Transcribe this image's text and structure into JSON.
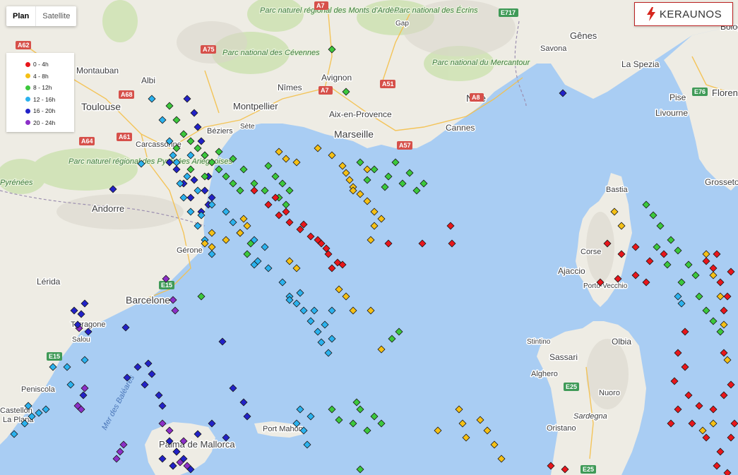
{
  "map_type": {
    "plan": "Plan",
    "satellite": "Satellite",
    "selected": "Plan"
  },
  "brand": {
    "name": "KERAUNOS"
  },
  "legend": [
    {
      "label": "0 - 4h",
      "color": "#e8161b"
    },
    {
      "label": "4 - 8h",
      "color": "#f5c015"
    },
    {
      "label": "8 - 12h",
      "color": "#3cc83c"
    },
    {
      "label": "12 - 16h",
      "color": "#2bb2ee"
    },
    {
      "label": "16 - 20h",
      "color": "#2222c8"
    },
    {
      "label": "20 - 24h",
      "color": "#8c2fc8"
    }
  ],
  "places": [
    "Montauban",
    "Albi",
    "Toulouse",
    "Carcassonne",
    "Andorre",
    "Lérida",
    "Tarragone",
    "Salou",
    "Barcelone",
    "Gérone",
    "Peniscola",
    "Castellón",
    "La Plana",
    "Montpellier",
    "Nîmes",
    "Avignon",
    "Sète",
    "Béziers",
    "Aix-en-Provence",
    "Marseille",
    "Gap",
    "Cannes",
    "Nice",
    "Gênes",
    "Savona",
    "La Spezia",
    "Pise",
    "Livourne",
    "Florence",
    "Grosseto",
    "Bastia",
    "Ajaccio",
    "Corse",
    "Porto-Vecchio",
    "Stintino",
    "Sassari",
    "Olbia",
    "Alghero",
    "Nuoro",
    "Sardegna",
    "Oristano",
    "Port Mahon",
    "Palma de Mallorca",
    "Bologna",
    "Mer des Baléares"
  ],
  "parks": [
    "Parc naturel régional des Pyrénées Ariégeoises",
    "Parc national des Cévennes",
    "Parc naturel régional des Monts d'Ardèche",
    "Parc national des Écrins",
    "Parc national du Mercantour",
    "Pyrénées"
  ],
  "roads": [
    "A62",
    "A68",
    "A61",
    "A64",
    "A75",
    "A7",
    "A7",
    "A51",
    "A57",
    "A8",
    "E717",
    "E76",
    "E15",
    "E15",
    "E25",
    "E25"
  ],
  "strikes": {
    "clusters": [
      {
        "bin": "0 - 4h",
        "points": [
          [
            360,
            270
          ],
          [
            380,
            290
          ],
          [
            395,
            305
          ],
          [
            410,
            315
          ],
          [
            425,
            325
          ],
          [
            440,
            335
          ],
          [
            455,
            345
          ],
          [
            465,
            360
          ],
          [
            478,
            372
          ],
          [
            470,
            380
          ],
          [
            430,
            318
          ],
          [
            405,
            300
          ],
          [
            390,
            280
          ],
          [
            450,
            340
          ],
          [
            462,
            352
          ],
          [
            485,
            375
          ],
          [
            550,
            345
          ],
          [
            598,
            345
          ],
          [
            640,
            345
          ],
          [
            638,
            320
          ],
          [
            860,
            345
          ],
          [
            880,
            360
          ],
          [
            900,
            350
          ],
          [
            920,
            370
          ],
          [
            940,
            360
          ],
          [
            900,
            390
          ],
          [
            875,
            395
          ],
          [
            915,
            400
          ],
          [
            850,
            400
          ],
          [
            1010,
            380
          ],
          [
            1020,
            400
          ],
          [
            1030,
            420
          ],
          [
            1000,
            370
          ],
          [
            1015,
            360
          ],
          [
            1035,
            385
          ],
          [
            1025,
            440
          ],
          [
            960,
            500
          ],
          [
            970,
            520
          ],
          [
            955,
            540
          ],
          [
            975,
            560
          ],
          [
            990,
            575
          ],
          [
            1010,
            580
          ],
          [
            1025,
            560
          ],
          [
            1035,
            545
          ],
          [
            980,
            600
          ],
          [
            1000,
            620
          ],
          [
            1020,
            640
          ],
          [
            1035,
            620
          ],
          [
            1040,
            600
          ],
          [
            950,
            600
          ],
          [
            960,
            580
          ],
          [
            1015,
            660
          ],
          [
            1030,
            670
          ],
          [
            780,
            660
          ],
          [
            800,
            665
          ],
          [
            970,
            470
          ],
          [
            1025,
            500
          ]
        ]
      },
      {
        "bin": "4 - 8h",
        "points": [
          [
            395,
            215
          ],
          [
            405,
            225
          ],
          [
            420,
            230
          ],
          [
            450,
            210
          ],
          [
            470,
            220
          ],
          [
            485,
            235
          ],
          [
            490,
            245
          ],
          [
            495,
            255
          ],
          [
            500,
            265
          ],
          [
            510,
            275
          ],
          [
            520,
            285
          ],
          [
            530,
            300
          ],
          [
            540,
            310
          ],
          [
            500,
            270
          ],
          [
            520,
            240
          ],
          [
            350,
            320
          ],
          [
            345,
            310
          ],
          [
            340,
            330
          ],
          [
            320,
            340
          ],
          [
            300,
            350
          ],
          [
            420,
            380
          ],
          [
            410,
            370
          ],
          [
            480,
            410
          ],
          [
            490,
            420
          ],
          [
            500,
            440
          ],
          [
            525,
            440
          ],
          [
            530,
            320
          ],
          [
            525,
            340
          ],
          [
            650,
            580
          ],
          [
            655,
            600
          ],
          [
            660,
            620
          ],
          [
            680,
            595
          ],
          [
            690,
            610
          ],
          [
            700,
            630
          ],
          [
            710,
            650
          ],
          [
            870,
            300
          ],
          [
            880,
            320
          ],
          [
            1000,
            360
          ],
          [
            1010,
            390
          ],
          [
            1020,
            420
          ],
          [
            1025,
            460
          ],
          [
            1030,
            510
          ],
          [
            995,
            610
          ],
          [
            1010,
            600
          ],
          [
            540,
            495
          ],
          [
            620,
            610
          ],
          [
            300,
            330
          ],
          [
            290,
            345
          ]
        ]
      },
      {
        "bin": "8 - 12h",
        "points": [
          [
            240,
            150
          ],
          [
            250,
            170
          ],
          [
            260,
            190
          ],
          [
            270,
            200
          ],
          [
            280,
            210
          ],
          [
            290,
            220
          ],
          [
            300,
            230
          ],
          [
            310,
            240
          ],
          [
            320,
            250
          ],
          [
            330,
            260
          ],
          [
            340,
            270
          ],
          [
            250,
            210
          ],
          [
            270,
            240
          ],
          [
            290,
            250
          ],
          [
            310,
            215
          ],
          [
            330,
            225
          ],
          [
            345,
            240
          ],
          [
            380,
            235
          ],
          [
            390,
            250
          ],
          [
            400,
            260
          ],
          [
            410,
            270
          ],
          [
            395,
            280
          ],
          [
            360,
            260
          ],
          [
            375,
            270
          ],
          [
            510,
            230
          ],
          [
            530,
            240
          ],
          [
            550,
            250
          ],
          [
            570,
            260
          ],
          [
            590,
            270
          ],
          [
            560,
            230
          ],
          [
            580,
            245
          ],
          [
            600,
            260
          ],
          [
            545,
            265
          ],
          [
            520,
            255
          ],
          [
            490,
            130
          ],
          [
            470,
            70
          ],
          [
            405,
            290
          ],
          [
            915,
            290
          ],
          [
            925,
            305
          ],
          [
            935,
            320
          ],
          [
            950,
            340
          ],
          [
            960,
            355
          ],
          [
            975,
            375
          ],
          [
            985,
            390
          ],
          [
            990,
            420
          ],
          [
            1000,
            440
          ],
          [
            1010,
            455
          ],
          [
            1020,
            470
          ],
          [
            930,
            350
          ],
          [
            945,
            375
          ],
          [
            965,
            400
          ],
          [
            470,
            580
          ],
          [
            480,
            595
          ],
          [
            500,
            600
          ],
          [
            510,
            580
          ],
          [
            530,
            590
          ],
          [
            540,
            600
          ],
          [
            520,
            610
          ],
          [
            505,
            570
          ],
          [
            285,
            420
          ],
          [
            350,
            360
          ],
          [
            355,
            345
          ],
          [
            565,
            470
          ],
          [
            555,
            480
          ],
          [
            510,
            665
          ]
        ]
      },
      {
        "bin": "12 - 16h",
        "points": [
          [
            215,
            140
          ],
          [
            230,
            170
          ],
          [
            240,
            200
          ],
          [
            250,
            230
          ],
          [
            255,
            260
          ],
          [
            260,
            280
          ],
          [
            270,
            300
          ],
          [
            280,
            320
          ],
          [
            290,
            340
          ],
          [
            300,
            360
          ],
          [
            280,
            270
          ],
          [
            265,
            250
          ],
          [
            245,
            220
          ],
          [
            270,
            220
          ],
          [
            300,
            290
          ],
          [
            285,
            305
          ],
          [
            320,
            300
          ],
          [
            330,
            315
          ],
          [
            340,
            330
          ],
          [
            360,
            340
          ],
          [
            375,
            350
          ],
          [
            380,
            380
          ],
          [
            365,
            370
          ],
          [
            400,
            400
          ],
          [
            410,
            420
          ],
          [
            420,
            430
          ],
          [
            430,
            440
          ],
          [
            440,
            455
          ],
          [
            450,
            470
          ],
          [
            455,
            485
          ],
          [
            465,
            500
          ],
          [
            425,
            415
          ],
          [
            445,
            440
          ],
          [
            460,
            460
          ],
          [
            470,
            480
          ],
          [
            360,
            375
          ],
          [
            200,
            232
          ],
          [
            55,
            585
          ],
          [
            45,
            590
          ],
          [
            65,
            580
          ],
          [
            35,
            600
          ],
          [
            20,
            615
          ],
          [
            40,
            575
          ],
          [
            75,
            520
          ],
          [
            95,
            520
          ],
          [
            120,
            510
          ],
          [
            100,
            545
          ],
          [
            420,
            600
          ],
          [
            430,
            610
          ],
          [
            440,
            590
          ],
          [
            425,
            580
          ],
          [
            435,
            630
          ],
          [
            960,
            420
          ],
          [
            965,
            430
          ],
          [
            410,
            425
          ],
          [
            470,
            440
          ]
        ]
      },
      {
        "bin": "16 - 20h",
        "points": [
          [
            265,
            140
          ],
          [
            275,
            160
          ],
          [
            280,
            180
          ],
          [
            285,
            200
          ],
          [
            290,
            220
          ],
          [
            295,
            250
          ],
          [
            275,
            255
          ],
          [
            290,
            270
          ],
          [
            295,
            290
          ],
          [
            285,
            300
          ],
          [
            270,
            280
          ],
          [
            300,
            280
          ],
          [
            250,
            240
          ],
          [
            260,
            260
          ],
          [
            240,
            230
          ],
          [
            180,
            535
          ],
          [
            195,
            520
          ],
          [
            210,
            515
          ],
          [
            205,
            545
          ],
          [
            215,
            530
          ],
          [
            225,
            560
          ],
          [
            230,
            575
          ],
          [
            105,
            440
          ],
          [
            115,
            445
          ],
          [
            110,
            460
          ],
          [
            120,
            430
          ],
          [
            125,
            470
          ],
          [
            240,
            625
          ],
          [
            250,
            640
          ],
          [
            260,
            650
          ],
          [
            245,
            660
          ],
          [
            270,
            665
          ],
          [
            230,
            650
          ],
          [
            280,
            615
          ],
          [
            300,
            600
          ],
          [
            320,
            620
          ],
          [
            330,
            550
          ],
          [
            345,
            570
          ],
          [
            350,
            590
          ],
          [
            315,
            484
          ],
          [
            178,
            464
          ],
          [
            160,
            268
          ],
          [
            797,
            132
          ],
          [
            118,
            560
          ]
        ]
      },
      {
        "bin": "20 - 24h",
        "points": [
          [
            120,
            550
          ],
          [
            115,
            580
          ],
          [
            110,
            575
          ],
          [
            170,
            640
          ],
          [
            175,
            630
          ],
          [
            165,
            650
          ],
          [
            230,
            600
          ],
          [
            240,
            610
          ],
          [
            250,
            640
          ],
          [
            255,
            655
          ],
          [
            245,
            660
          ],
          [
            265,
            660
          ],
          [
            245,
            425
          ],
          [
            248,
            440
          ],
          [
            235,
            395
          ],
          [
            112,
            465
          ],
          [
            260,
            625
          ]
        ]
      }
    ]
  }
}
